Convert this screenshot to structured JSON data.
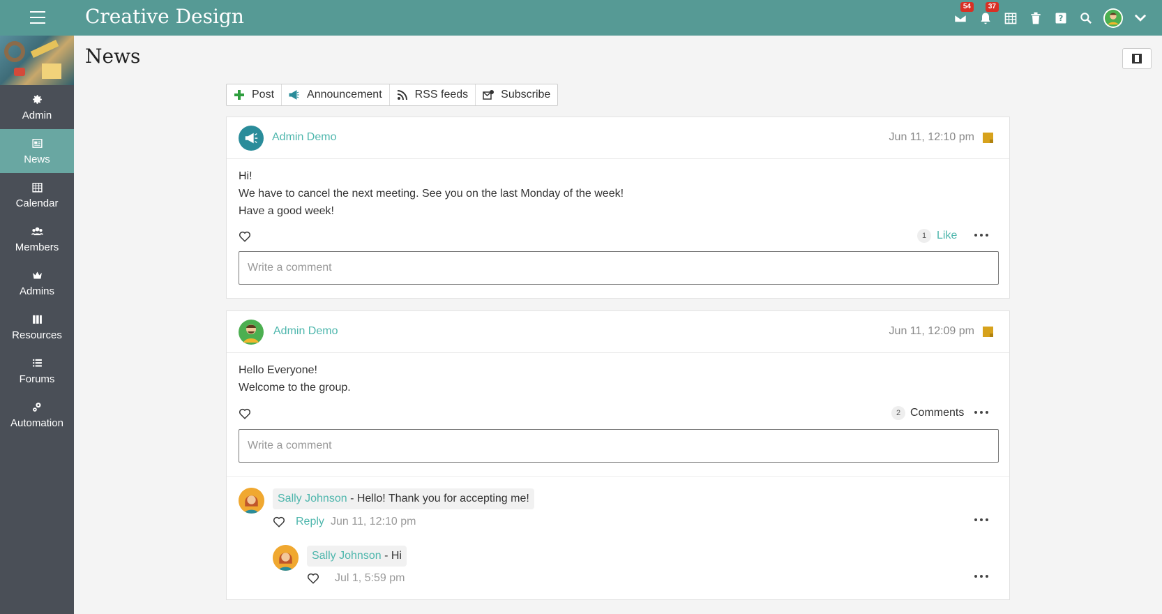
{
  "app": {
    "title": "Creative Design"
  },
  "topbar": {
    "icons": [
      {
        "name": "messages-icon",
        "badge": "54"
      },
      {
        "name": "notifications-icon",
        "badge": "37"
      },
      {
        "name": "calendar-icon"
      },
      {
        "name": "trash-icon"
      },
      {
        "name": "help-icon"
      },
      {
        "name": "search-icon"
      },
      {
        "name": "user-avatar"
      },
      {
        "name": "chevron-down-icon"
      }
    ]
  },
  "sidebar": {
    "items": [
      {
        "label": "Admin",
        "icon": "gear-icon"
      },
      {
        "label": "News",
        "icon": "news-icon",
        "active": true
      },
      {
        "label": "Calendar",
        "icon": "calendar-icon"
      },
      {
        "label": "Members",
        "icon": "members-icon"
      },
      {
        "label": "Admins",
        "icon": "crown-icon"
      },
      {
        "label": "Resources",
        "icon": "resources-icon"
      },
      {
        "label": "Forums",
        "icon": "forums-icon"
      },
      {
        "label": "Automation",
        "icon": "automation-icon"
      }
    ]
  },
  "page": {
    "title": "News"
  },
  "toolbar": {
    "post": "Post",
    "announcement": "Announcement",
    "rss": "RSS feeds",
    "subscribe": "Subscribe"
  },
  "posts": [
    {
      "author": "Admin Demo",
      "date": "Jun 11, 12:10 pm",
      "lines": [
        "Hi!",
        "We have to cancel the next meeting. See you on the last Monday of the week!",
        "Have a good week!"
      ],
      "count": "1",
      "action": "Like",
      "comment_placeholder": "Write a comment"
    },
    {
      "author": "Admin Demo",
      "date": "Jun 11, 12:09 pm",
      "lines": [
        "Hello Everyone!",
        "Welcome to the group."
      ],
      "count": "2",
      "action": "Comments",
      "comment_placeholder": "Write a comment",
      "comments": [
        {
          "author": "Sally Johnson",
          "text": " - Hello! Thank you for accepting me!",
          "reply_label": "Reply",
          "date": "Jun 11, 12:10 pm"
        },
        {
          "author": "Sally Johnson",
          "text": " - Hi",
          "date": "Jul 1, 5:59 pm"
        }
      ]
    }
  ],
  "colors": {
    "topbar": "#569a95",
    "sidebar": "#4a4f57",
    "active": "#69a7a2",
    "link": "#4db6ac",
    "sticky": "#d7a21c",
    "badge": "#d93025"
  }
}
